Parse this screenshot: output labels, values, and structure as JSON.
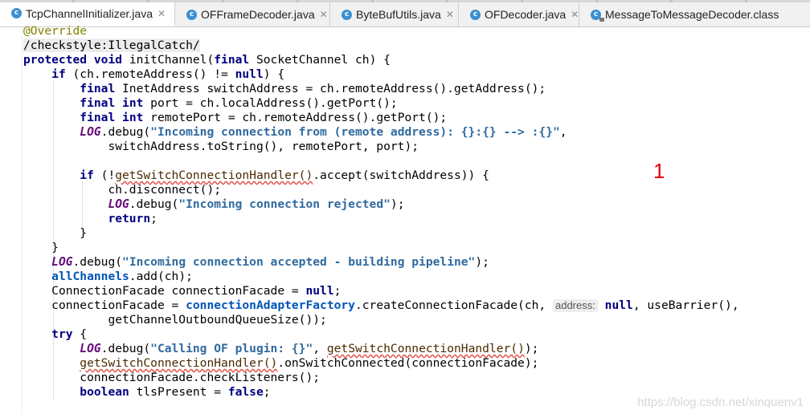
{
  "tabs": [
    {
      "label": "TcpChannelInitializer.java",
      "icon": "class-icon",
      "icon_glyph": "c",
      "active": true,
      "close": "✕"
    },
    {
      "label": "OFFrameDecoder.java",
      "icon": "class-icon",
      "icon_glyph": "c",
      "active": false,
      "close": "✕"
    },
    {
      "label": "ByteBufUtils.java",
      "icon": "class-icon",
      "icon_glyph": "c",
      "active": false,
      "close": "✕"
    },
    {
      "label": "OFDecoder.java",
      "icon": "class-icon",
      "icon_glyph": "c",
      "active": false,
      "close": "✕"
    },
    {
      "label": "MessageToMessageDecoder.class",
      "icon": "locked-class-icon",
      "icon_glyph": "c",
      "active": false,
      "close": ""
    }
  ],
  "code": {
    "l1": "@Override",
    "l2": "/checkstyle:IllegalCatch/",
    "l3_kw1": "protected",
    "l3_kw2": "void",
    "l3_a": " initChannel(",
    "l3_kw3": "final",
    "l3_b": " SocketChannel ch) {",
    "l4_kw1": "if",
    "l4_a": " (ch.remoteAddress() != ",
    "l4_kw2": "null",
    "l4_b": ") {",
    "l5_kw": "final",
    "l5_a": " InetAddress switchAddress = ch.remoteAddress().getAddress();",
    "l6_kw1": "final",
    "l6_kw2": "int",
    "l6_a": " port = ch.localAddress().getPort();",
    "l7_kw1": "final",
    "l7_kw2": "int",
    "l7_a": " remotePort = ch.remoteAddress().getPort();",
    "l8_fld": "LOG",
    "l8_a": ".debug(",
    "l8_str": "\"Incoming connection from (remote address): {}:{} --> :{}\"",
    "l8_b": ",",
    "l9": "switchAddress.toString(), remotePort, port);",
    "l11_kw": "if",
    "l11_a": " (!",
    "l11_err": "getSwitchConnectionHandler()",
    "l11_b": ".accept(switchAddress)) {",
    "l12": "ch.disconnect();",
    "l13_fld": "LOG",
    "l13_a": ".debug(",
    "l13_str": "\"Incoming connection rejected\"",
    "l13_b": ");",
    "l14_kw": "return",
    "l14_a": ";",
    "l15": "}",
    "l16": "}",
    "l17_fld": "LOG",
    "l17_a": ".debug(",
    "l17_str": "\"Incoming connection accepted - building pipeline\"",
    "l17_b": ");",
    "l18_sfld": "allChannels",
    "l18_a": ".add(ch);",
    "l19_a": "ConnectionFacade connectionFacade = ",
    "l19_kw": "null",
    "l19_b": ";",
    "l20_a": "connectionFacade = ",
    "l20_sfld": "connectionAdapterFactory",
    "l20_b": ".createConnectionFacade(ch, ",
    "l20_hint": "address:",
    "l20_kw": "null",
    "l20_c": ", useBarrier(),",
    "l21": "getChannelOutboundQueueSize());",
    "l22_kw": "try",
    "l22_a": " {",
    "l23_fld": "LOG",
    "l23_a": ".debug(",
    "l23_str": "\"Calling OF plugin: {}\"",
    "l23_b": ", ",
    "l23_err": "getSwitchConnectionHandler()",
    "l23_c": ");",
    "l24_err": "getSwitchConnectionHandler()",
    "l24_a": ".onSwitchConnected(connectionFacade);",
    "l25": "connectionFacade.checkListeners();",
    "l26_kw1": "boolean",
    "l26_a": " tlsPresent = ",
    "l26_kw2": "false",
    "l26_b": ";"
  },
  "annotation_marker": "1",
  "watermark": "https://blog.csdn.net/xinquenv1",
  "colors": {
    "keyword": "#000080",
    "string": "#2f6a9e",
    "marker": "#e00000",
    "tab_icon": "#3b8fd0"
  }
}
